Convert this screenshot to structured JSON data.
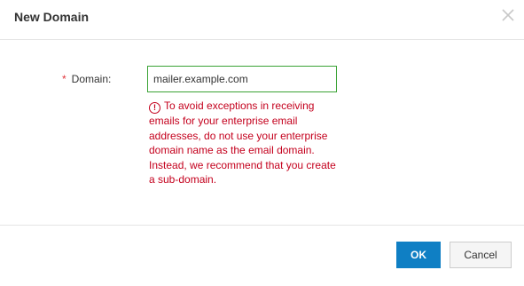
{
  "dialog": {
    "title": "New Domain",
    "close_icon": "close-icon"
  },
  "form": {
    "required_mark": "*",
    "domain_label": "Domain:",
    "domain_value": "mailer.example.com",
    "error_icon": "exclamation-circle-icon",
    "error_symbol": "!",
    "error_message": "To avoid exceptions in receiving emails for your enterprise email addresses, do not use your enterprise domain name as the email domain. Instead, we recommend that you create a sub-domain."
  },
  "footer": {
    "ok_label": "OK",
    "cancel_label": "Cancel"
  },
  "colors": {
    "primary": "#0f7fc4",
    "error": "#c4001d",
    "input_border_valid": "#3aa335",
    "required": "#e0343a"
  }
}
